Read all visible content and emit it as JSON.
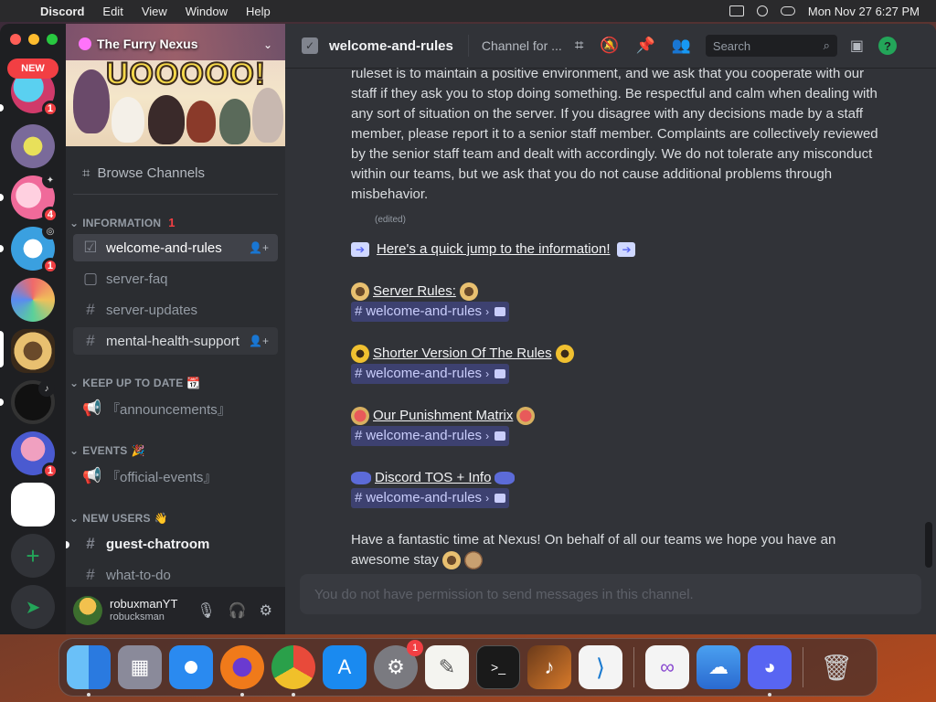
{
  "menubar": {
    "app": "Discord",
    "items": [
      "Edit",
      "View",
      "Window",
      "Help"
    ],
    "clock": "Mon Nov 27  6:27 PM"
  },
  "servers": {
    "new_label": "NEW",
    "badges": [
      "1",
      "4",
      "1",
      "1"
    ]
  },
  "sidebar": {
    "server_name": "The Furry Nexus",
    "browse": "Browse Channels",
    "categories": {
      "information": "INFORMATION",
      "information_mention": "1",
      "keep_up": "KEEP UP TO DATE",
      "events": "EVENTS",
      "new_users": "NEW USERS"
    },
    "channels": {
      "welcome": "welcome-and-rules",
      "faq": "server-faq",
      "updates": "server-updates",
      "mental": "mental-health-support",
      "announcements": "『announcements』",
      "official_events": "『official-events』",
      "guest": "guest-chatroom",
      "todo": "what-to-do"
    },
    "user": {
      "name": "robuxmanYT",
      "tag": "robucksman"
    }
  },
  "topbar": {
    "title": "welcome-and-rules",
    "topic": "Channel for ...",
    "search_placeholder": "Search"
  },
  "messages": {
    "rules_paragraph": "ruleset is to maintain a positive environment, and we ask that you cooperate with our staff if they ask you to stop doing something. Be respectful and calm when dealing with any sort of situation on the server. If you disagree with any decisions made by a staff member, please report it to a senior staff member. Complaints are collectively reviewed by the senior staff team and dealt with accordingly. We do not tolerate any misconduct within our teams, but we ask that you do not cause additional problems through misbehavior.",
    "edited": "(edited)",
    "jump_link": "Here's a quick jump to the information!",
    "sections": [
      {
        "title": "Server Rules:",
        "channel": "welcome-and-rules"
      },
      {
        "title": "Shorter Version Of The Rules",
        "channel": "welcome-and-rules"
      },
      {
        "title": "Our Punishment Matrix",
        "channel": "welcome-and-rules"
      },
      {
        "title": "Discord TOS + Info",
        "channel": "welcome-and-rules"
      }
    ],
    "closing": "Have a fantastic time at Nexus! On behalf of all our teams we hope you have an awesome stay"
  },
  "composer": {
    "placeholder": "You do not have permission to send messages in this channel."
  },
  "dock": {
    "settings_badge": "1"
  },
  "colors": {
    "accent": "#5865f2",
    "mention": "#f23f43",
    "online_green": "#23a559"
  }
}
